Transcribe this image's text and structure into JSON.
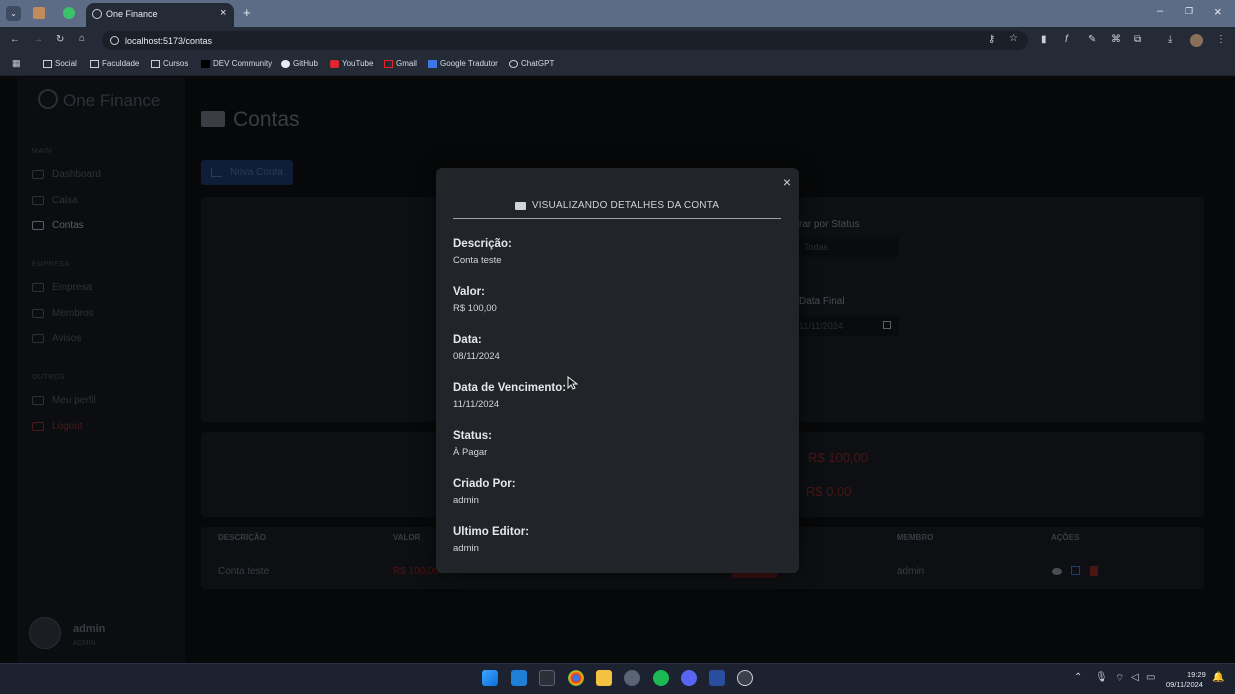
{
  "browser": {
    "tab_title": "One Finance",
    "url": "localhost:5173/contas",
    "bookmarks": [
      "Social",
      "Faculdade",
      "Cursos",
      "DEV Community",
      "GitHub",
      "YouTube",
      "Gmail",
      "Google Tradutor",
      "ChatGPT"
    ]
  },
  "app": {
    "brand": "One Finance",
    "page_title": "Contas",
    "new_button": "Nova Conta",
    "sidebar": {
      "section_main": "MAIN",
      "section_empresa": "EMPRESA",
      "section_outros": "OUTROS",
      "items": [
        "Dashboard",
        "Caixa",
        "Contas",
        "Empresa",
        "Membros",
        "Avisos",
        "Meu perfil",
        "Logout"
      ]
    },
    "filters": {
      "status_label": "rar por Status",
      "status_value": "Todas",
      "date_final_label": "Data Final",
      "date_final_value": "11/11/2024"
    },
    "totals": {
      "a_pagar": "R$ 100,00",
      "pago": "R$ 0,00"
    },
    "table": {
      "headers": [
        "DESCRIÇÃO",
        "VALOR",
        "MEMBRO",
        "AÇÕES"
      ],
      "row": {
        "descricao": "Conta teste",
        "valor": "R$ 100,00",
        "membro": "admin"
      }
    },
    "user": {
      "name": "admin",
      "role": "ADMIN"
    }
  },
  "modal": {
    "title": "VISUALIZANDO DETALHES DA CONTA",
    "fields": [
      {
        "label": "Descrição:",
        "value": "Conta teste"
      },
      {
        "label": "Valor:",
        "value": "R$ 100,00"
      },
      {
        "label": "Data:",
        "value": "08/11/2024"
      },
      {
        "label": "Data de Vencimento:",
        "value": "11/11/2024"
      },
      {
        "label": "Status:",
        "value": "À Pagar"
      },
      {
        "label": "Criado Por:",
        "value": "admin"
      },
      {
        "label": "Ultimo Editor:",
        "value": "admin"
      }
    ]
  },
  "taskbar": {
    "time": "19:29",
    "date": "09/11/2024"
  },
  "colors": {
    "accent_blue": "#1e4a9e",
    "danger_red": "#b02a2a",
    "modal_bg": "#212429"
  }
}
